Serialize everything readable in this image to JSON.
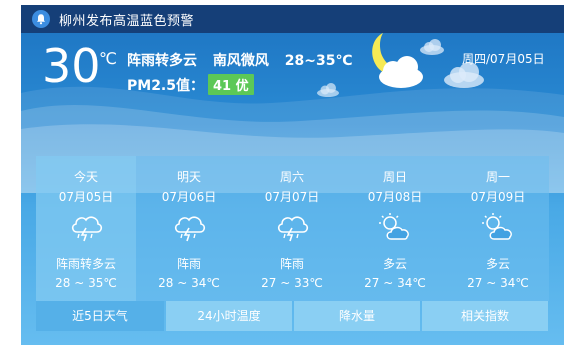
{
  "alert": {
    "text": "柳州发布高温蓝色预警",
    "icon": "bell-icon"
  },
  "current": {
    "temperature": "30",
    "unit": "℃",
    "condition": "阵雨转多云",
    "wind": "南风微风",
    "range": "28~35℃",
    "pm_label": "PM2.5值：",
    "aqi": "41 优",
    "aqi_color": "#5cc857",
    "date": "周四/07月05日"
  },
  "forecast": [
    {
      "day": "今天",
      "date": "07月05日",
      "icon": "thunder-rain-icon",
      "desc": "阵雨转多云",
      "range": "28 ~ 35℃"
    },
    {
      "day": "明天",
      "date": "07月06日",
      "icon": "thunder-rain-icon",
      "desc": "阵雨",
      "range": "28 ~ 34℃"
    },
    {
      "day": "周六",
      "date": "07月07日",
      "icon": "thunder-rain-icon",
      "desc": "阵雨",
      "range": "27 ~ 33℃"
    },
    {
      "day": "周日",
      "date": "07月08日",
      "icon": "partly-cloudy-icon",
      "desc": "多云",
      "range": "27 ~ 34℃"
    },
    {
      "day": "周一",
      "date": "07月09日",
      "icon": "partly-cloudy-icon",
      "desc": "多云",
      "range": "27 ~ 34℃"
    }
  ],
  "tabs": [
    "近5日天气",
    "24小时温度",
    "降水量",
    "相关指数"
  ]
}
